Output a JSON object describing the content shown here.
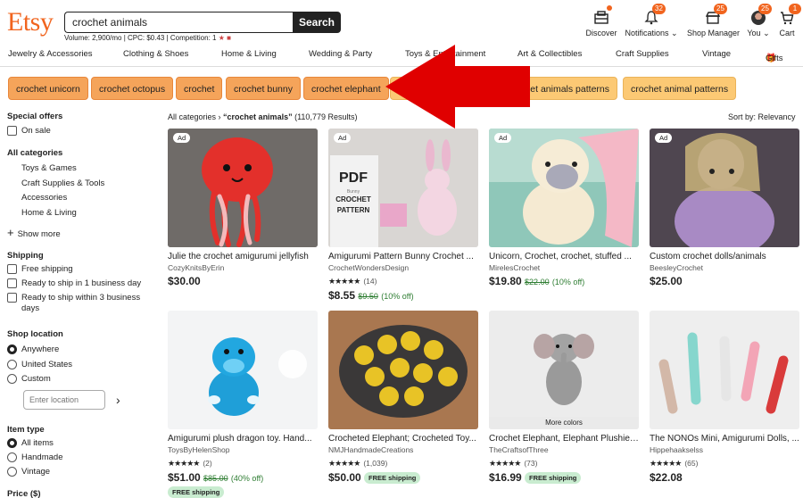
{
  "header": {
    "logo": "Etsy",
    "search_value": "crochet animals",
    "search_button": "Search",
    "volume_text": "Volume: 2,900/mo | CPC: $0.43 | Competition: 1",
    "nav": [
      {
        "label": "Discover",
        "badge": ""
      },
      {
        "label": "Notifications",
        "badge": "32"
      },
      {
        "label": "Shop Manager",
        "badge": "25"
      },
      {
        "label": "You",
        "badge": "25"
      },
      {
        "label": "Cart",
        "badge": "1"
      }
    ]
  },
  "categories": [
    "Jewelry & Accessories",
    "Clothing & Shoes",
    "Home & Living",
    "Wedding & Party",
    "Toys & Entertainment",
    "Art & Collectibles",
    "Craft Supplies",
    "Vintage",
    "Gifts"
  ],
  "chips": [
    "crochet unicorn",
    "crochet octopus",
    "crochet",
    "crochet bunny",
    "crochet elephant",
    "crochet animals patterns",
    "crochet animal patterns"
  ],
  "sidebar": {
    "special_offers": "Special offers",
    "on_sale": "On sale",
    "all_categories": "All categories",
    "cats": [
      "Toys & Games",
      "Craft Supplies & Tools",
      "Accessories",
      "Home & Living"
    ],
    "show_more": "Show more",
    "shipping": "Shipping",
    "free_shipping": "Free shipping",
    "ready_1": "Ready to ship in 1 business day",
    "ready_3": "Ready to ship within 3 business days",
    "shop_location": "Shop location",
    "loc_options": [
      "Anywhere",
      "United States",
      "Custom"
    ],
    "location_placeholder": "Enter location",
    "item_type": "Item type",
    "item_options": [
      "All items",
      "Handmade",
      "Vintage"
    ],
    "price": "Price ($)"
  },
  "results": {
    "breadcrumb_root": "All categories",
    "query": "“crochet animals”",
    "count": "(110,779 Results)",
    "sort": "Sort by: Relevancy"
  },
  "listings": [
    {
      "title": "Julie the crochet amigurumi jellyfish",
      "shop": "CozyKnitsByErin",
      "price": "$30.00",
      "orig": "",
      "disc": "",
      "rating": "",
      "reviews": "",
      "ad": "Ad",
      "ship": "",
      "img_color": "#7a7470",
      "accent": "#e3302b"
    },
    {
      "title": "Amigurumi Pattern Bunny Crochet ...",
      "shop": "CrochetWondersDesign",
      "price": "$8.55",
      "orig": "$9.50",
      "disc": "(10% off)",
      "rating": "★★★★★",
      "reviews": "(14)",
      "ad": "Ad",
      "ship": "",
      "img_color": "#d8d4d2",
      "accent": "#e9a7c9"
    },
    {
      "title": "Unicorn, Crochet, crochet, stuffed ...",
      "shop": "MirelesCrochet",
      "price": "$19.80",
      "orig": "$22.00",
      "disc": "(10% off)",
      "rating": "",
      "reviews": "",
      "ad": "Ad",
      "ship": "",
      "img_color": "#8ec6b8",
      "accent": "#f6e8cf"
    },
    {
      "title": "Custom crochet dolls/animals",
      "shop": "BeesleyCrochet",
      "price": "$25.00",
      "orig": "",
      "disc": "",
      "rating": "",
      "reviews": "",
      "ad": "Ad",
      "ship": "",
      "img_color": "#5b4c56",
      "accent": "#a88ac4"
    },
    {
      "title": "Amigurumi plush dragon toy. Hand...",
      "shop": "ToysByHelenShop",
      "price": "$51.00",
      "orig": "$85.00",
      "disc": "(40% off)",
      "rating": "★★★★★",
      "reviews": "(2)",
      "ad": "",
      "ship": "FREE shipping",
      "img_color": "#f2f3f4",
      "accent": "#1f9fd8"
    },
    {
      "title": "Crocheted Elephant; Crocheted Toy...",
      "shop": "NMJHandmadeCreations",
      "price": "$50.00",
      "orig": "",
      "disc": "",
      "rating": "★★★★★",
      "reviews": "(1,039)",
      "ad": "",
      "ship": "FREE shipping",
      "img_color": "#b9865a",
      "accent": "#e8c326"
    },
    {
      "title": "Crochet Elephant, Elephant Plushie,...",
      "shop": "TheCraftsofThree",
      "price": "$16.99",
      "orig": "",
      "disc": "",
      "rating": "★★★★★",
      "reviews": "(73)",
      "ad": "",
      "ship": "FREE shipping",
      "img_color": "#eeeeee",
      "accent": "#9a9a9a",
      "more": "More colors"
    },
    {
      "title": "The NONOs Mini, Amigurumi Dolls, ...",
      "shop": "Hippehaakselss",
      "price": "$22.08",
      "orig": "",
      "disc": "",
      "rating": "★★★★★",
      "reviews": "(65)",
      "ad": "",
      "ship": "",
      "img_color": "#ededed",
      "accent": "#d93b3b"
    }
  ],
  "colors": {
    "brand": "#f1641e",
    "chip_dark": "#f5a45a",
    "chip_light": "#fcc974",
    "arrow": "#e00000"
  }
}
